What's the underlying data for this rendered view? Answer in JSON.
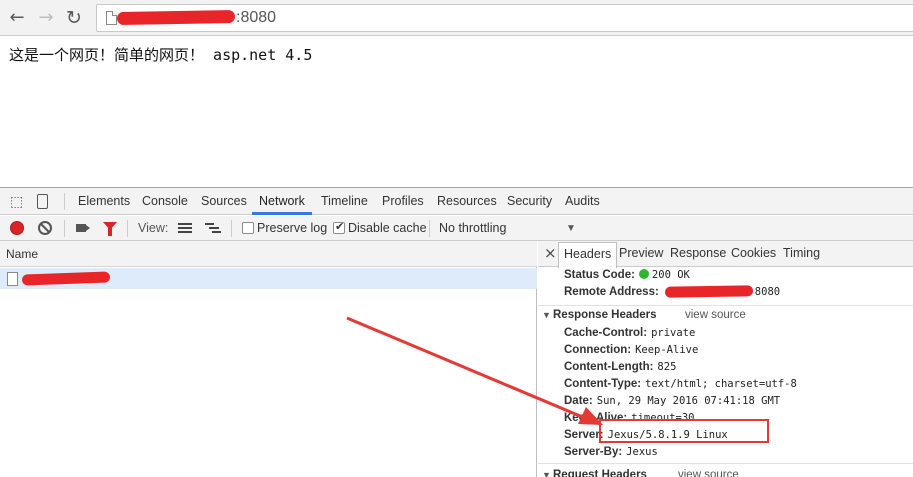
{
  "browser": {
    "url_suffix": ":8080",
    "nav": {
      "back": "←",
      "forward": "→",
      "reload": "↻"
    }
  },
  "page": {
    "text": "这是一个网页！简单的网页！ asp.net 4.5"
  },
  "devtools": {
    "tabs": [
      "Elements",
      "Console",
      "Sources",
      "Network",
      "Timeline",
      "Profiles",
      "Resources",
      "Security",
      "Audits"
    ],
    "active_tab": "Network",
    "filterbar": {
      "view_label": "View:",
      "preserve_log": "Preserve log",
      "disable_cache": "Disable cache",
      "throttling": "No throttling",
      "dropdown_arrow": "▼"
    },
    "list": {
      "name_header": "Name"
    },
    "detail": {
      "close": "×",
      "tabs": [
        "Headers",
        "Preview",
        "Response",
        "Cookies",
        "Timing"
      ],
      "active_tab": "Headers",
      "general": {
        "status_code_label": "Status Code:",
        "status_code_value": "200 OK",
        "remote_address_label": "Remote Address:",
        "remote_address_suffix": "8080"
      },
      "response_headers_title": "Response Headers",
      "view_source": "view source",
      "response_headers": [
        {
          "key": "Cache-Control:",
          "value": "private"
        },
        {
          "key": "Connection:",
          "value": "Keep-Alive"
        },
        {
          "key": "Content-Length:",
          "value": "825"
        },
        {
          "key": "Content-Type:",
          "value": "text/html; charset=utf-8"
        },
        {
          "key": "Date:",
          "value": "Sun, 29 May 2016 07:41:18 GMT"
        },
        {
          "key": "Keep-Alive:",
          "value": "timeout=30"
        },
        {
          "key": "Server:",
          "value": "Jexus/5.8.1.9 Linux"
        },
        {
          "key": "Server-By:",
          "value": "Jexus"
        }
      ],
      "request_headers_title": "Request Headers"
    }
  },
  "colors": {
    "annotation_red": "#e53935",
    "tab_accent": "#3879d9",
    "status_green": "#2fb52f"
  }
}
